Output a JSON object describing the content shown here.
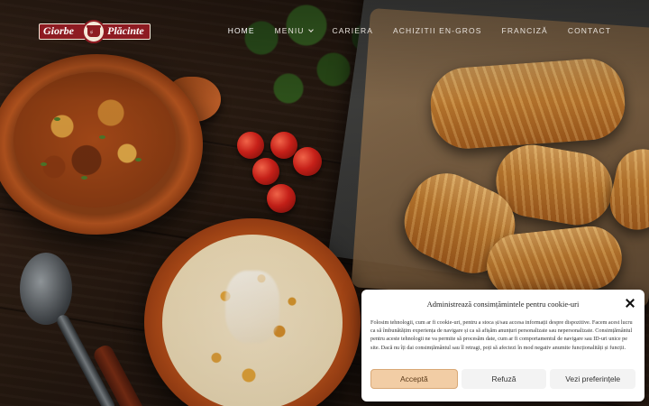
{
  "brand": {
    "word_left": "Giorbe",
    "word_right": "Plăcinte",
    "pot_text": "și"
  },
  "nav": {
    "items": [
      {
        "label": "HOME",
        "active": true,
        "dropdown": false
      },
      {
        "label": "MENIU",
        "active": false,
        "dropdown": true
      },
      {
        "label": "CARIERA",
        "active": false,
        "dropdown": false
      },
      {
        "label": "ACHIZITII EN-GROS",
        "active": false,
        "dropdown": false
      },
      {
        "label": "FRANCIZĂ",
        "active": false,
        "dropdown": false
      },
      {
        "label": "CONTACT",
        "active": false,
        "dropdown": false
      }
    ]
  },
  "cookie": {
    "title": "Administrează consimțămintele pentru cookie-uri",
    "body": "Folosim tehnologii, cum ar fi cookie-uri, pentru a stoca și/sau accesa informații despre dispozitive. Facem acest lucru ca să îmbunătățim experiența de navigare și ca să afișăm anunțuri personalizate sau nepersonalizate. Consimțământul pentru aceste tehnologii ne va permite să procesăm date, cum ar fi comportamentul de navigare sau ID-uri unice pe site. Dacă nu îți dai consimțământul sau îl retragi, poți să afectezi în mod negativ anumite funcționalități și funcții.",
    "accept_label": "Acceptă",
    "refuse_label": "Refuză",
    "prefs_label": "Vezi preferințele"
  },
  "colors": {
    "brand_red": "#8e1b22",
    "accept_bg": "#f2cda5"
  }
}
